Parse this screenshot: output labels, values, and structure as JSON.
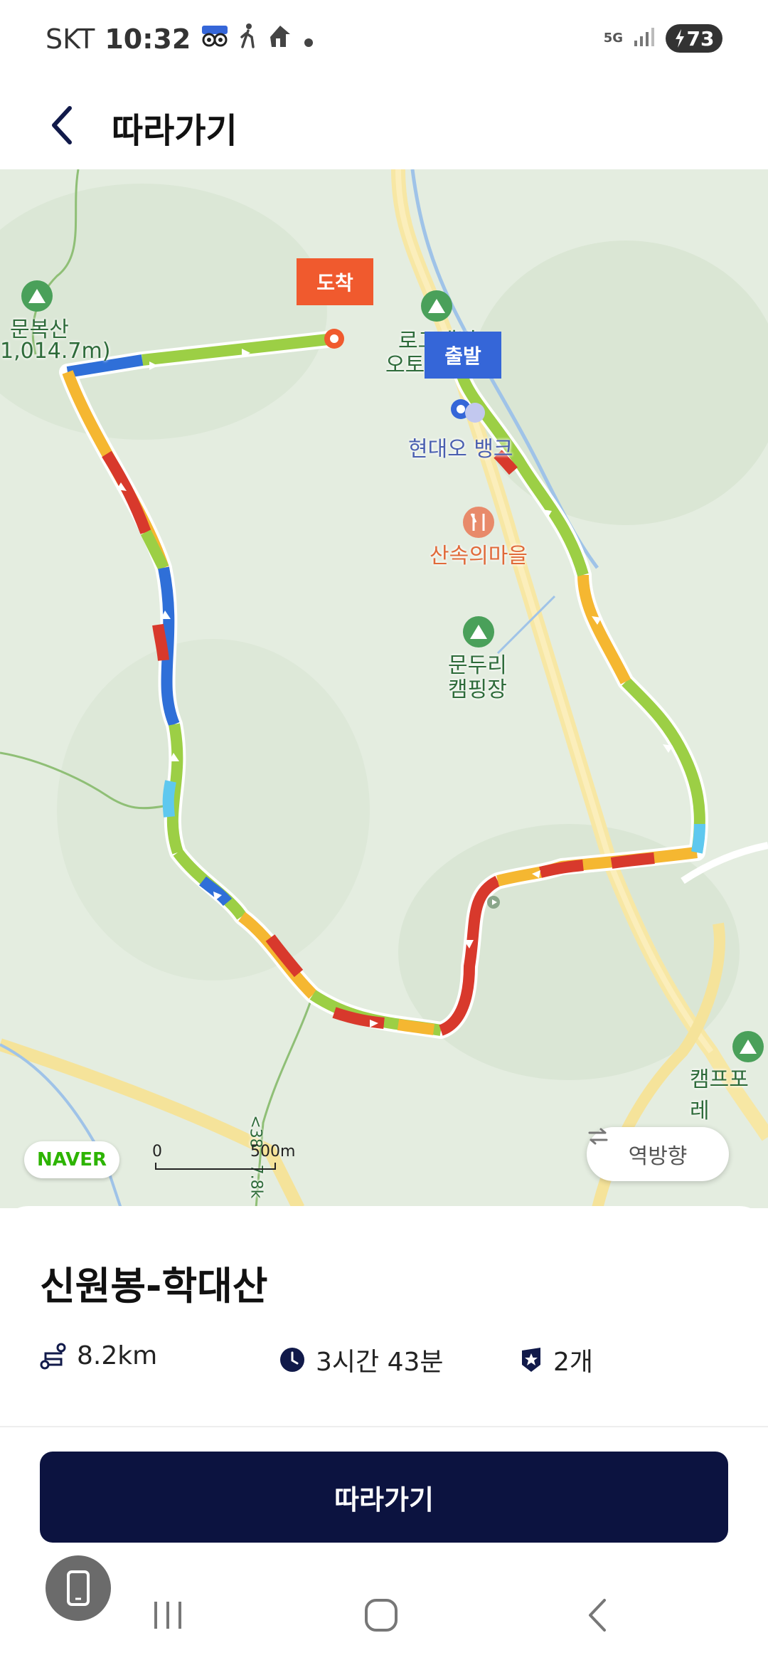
{
  "status_bar": {
    "carrier": "SKT",
    "time": "10:32",
    "network": "5G",
    "battery": "73",
    "icons": [
      "tripadvisor-icon",
      "walking-icon",
      "route-icon",
      "dot-icon",
      "signal-icon",
      "battery-charging-icon"
    ]
  },
  "header": {
    "title": "따라가기",
    "back_icon": "chevron-left-icon"
  },
  "map": {
    "markers": {
      "arrive_label": "도착",
      "depart_label": "출발"
    },
    "labels": {
      "mountain_name": "문복산",
      "mountain_height": "1,014.7m)",
      "camp_top": "로그캐빈",
      "camp_top_line2": "오토",
      "poi_bank": "현대오 뱅크",
      "restaurant": "산속의마을",
      "campsite_name": "문두리",
      "campsite_line2": "캠핑장",
      "campsite_right": "캠프포레",
      "road_label": "<38",
      "road_label2": "7.8k"
    },
    "naver_logo": "NAVER",
    "scale": {
      "zero": "0",
      "distance": "500m"
    },
    "reverse_button": "역방향",
    "colors": {
      "route_green": "#9ccf45",
      "route_yellow": "#f5b731",
      "route_red": "#d8392c",
      "route_blue": "#2f6fd8",
      "route_cyan": "#5ec8ef",
      "road": "#f5e39a",
      "water": "#9fc3e8"
    }
  },
  "course": {
    "title": "신원봉-학대산",
    "distance": "8.2km",
    "duration": "3시간 43분",
    "checkpoints": "2개"
  },
  "follow_button": "따라가기",
  "nav": {
    "recent_icon": "recent-apps-icon",
    "home_icon": "home-icon",
    "back_icon": "back-icon"
  }
}
